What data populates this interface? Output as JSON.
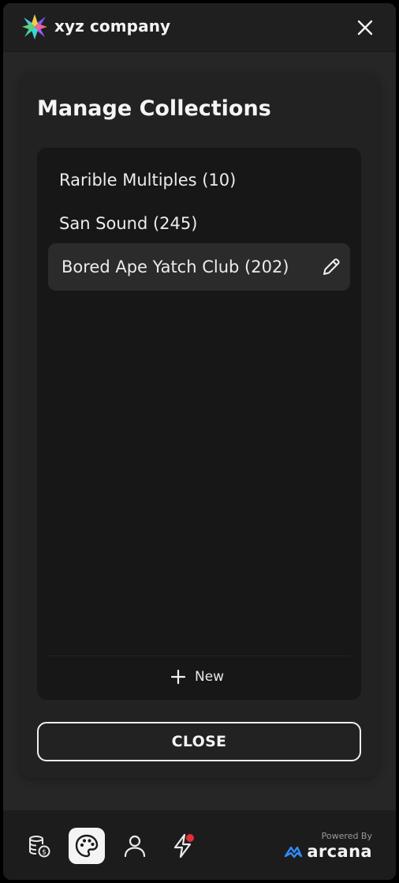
{
  "header": {
    "company_name": "xyz company"
  },
  "panel": {
    "title": "Manage Collections",
    "collections": [
      {
        "label": "Rarible Multiples (10)",
        "selected": false
      },
      {
        "label": "San Sound (245)",
        "selected": false
      },
      {
        "label": "Bored Ape Yatch Club (202)",
        "selected": true
      }
    ],
    "new_label": "New",
    "close_label": "CLOSE"
  },
  "footer": {
    "nav": [
      {
        "icon": "coins-icon",
        "active": false
      },
      {
        "icon": "palette-icon",
        "active": true
      },
      {
        "icon": "user-icon",
        "active": false
      },
      {
        "icon": "lightning-icon",
        "active": false,
        "notification_dot": true
      }
    ],
    "powered_by": "Powered By",
    "brand": "arcana"
  },
  "colors": {
    "background": "#262626",
    "card": "#222222",
    "list_box": "#171717",
    "selected_item": "#2b2b2b",
    "notification": "#e0303a",
    "arcana_blue": "#2f8cf5"
  }
}
